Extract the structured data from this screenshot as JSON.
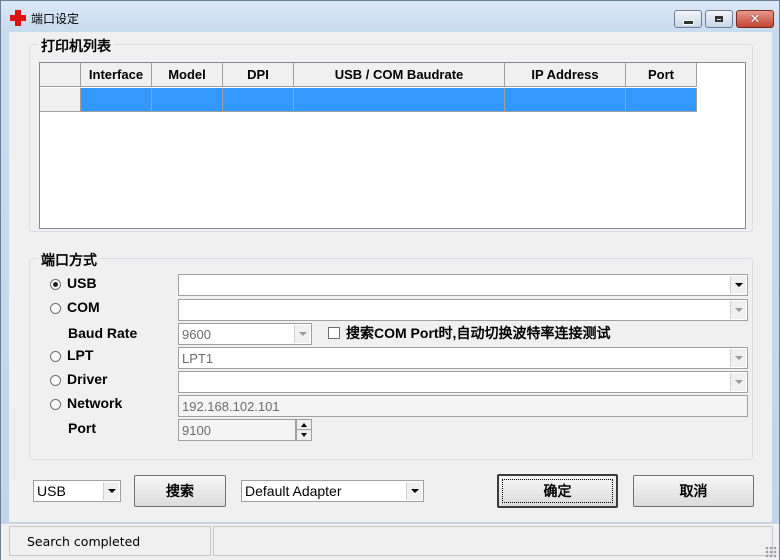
{
  "window": {
    "title": "端口设定"
  },
  "printer_list": {
    "legend": "打印机列表",
    "columns": [
      "",
      "Interface",
      "Model",
      "DPI",
      "USB / COM Baudrate",
      "IP Address",
      "Port"
    ]
  },
  "port_mode": {
    "legend": "端口方式",
    "usb": {
      "label": "USB",
      "selected": true,
      "value": ""
    },
    "com": {
      "label": "COM",
      "selected": false,
      "value": ""
    },
    "baud_rate": {
      "label": "Baud Rate",
      "value": "9600"
    },
    "auto_baud_check": {
      "label": "搜索COM Port时,自动切换波特率连接测试",
      "checked": false
    },
    "lpt": {
      "label": "LPT",
      "selected": false,
      "value": "LPT1"
    },
    "driver": {
      "label": "Driver",
      "selected": false,
      "value": ""
    },
    "network": {
      "label": "Network",
      "selected": false,
      "value": "192.168.102.101"
    },
    "port": {
      "label": "Port",
      "value": "9100"
    }
  },
  "bottom": {
    "interface_select": "USB",
    "search_button": "搜索",
    "adapter_select": "Default Adapter",
    "ok_button": "确定",
    "cancel_button": "取消"
  },
  "statusbar": {
    "message": "Search completed"
  },
  "colors": {
    "selection": "#3399ff",
    "close_button": "#c4432f"
  }
}
